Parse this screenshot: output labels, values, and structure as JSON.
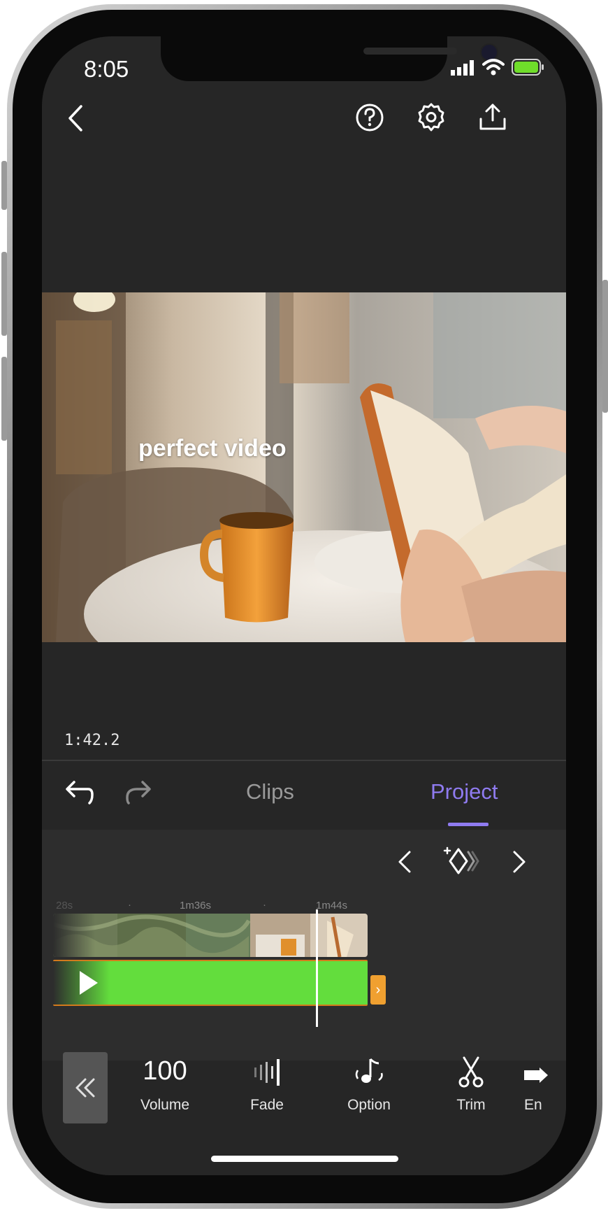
{
  "status_bar": {
    "time": "8:05"
  },
  "top_bar": {
    "back_icon": "chevron-left-icon",
    "help_icon": "help-circle-icon",
    "settings_icon": "gear-icon",
    "share_icon": "upload-icon"
  },
  "preview": {
    "overlay_text": "perfect video",
    "time_code": "1:42.2"
  },
  "tabs": {
    "clips": "Clips",
    "project": "Project",
    "active_color": "#8f7bf0"
  },
  "timeline": {
    "ruler_labels": [
      "28s",
      "1m36s",
      "1m44s"
    ],
    "audio_color": "#63dd3d",
    "handle_color": "#f0a030",
    "handle_glyph": "›"
  },
  "tools": [
    {
      "value": "100",
      "label": "Volume"
    },
    {
      "label": "Fade",
      "icon": "fade-icon"
    },
    {
      "label": "Option",
      "icon": "music-note-icon"
    },
    {
      "label": "Trim",
      "icon": "scissors-icon"
    },
    {
      "label": "En",
      "icon": "partial-icon"
    }
  ]
}
